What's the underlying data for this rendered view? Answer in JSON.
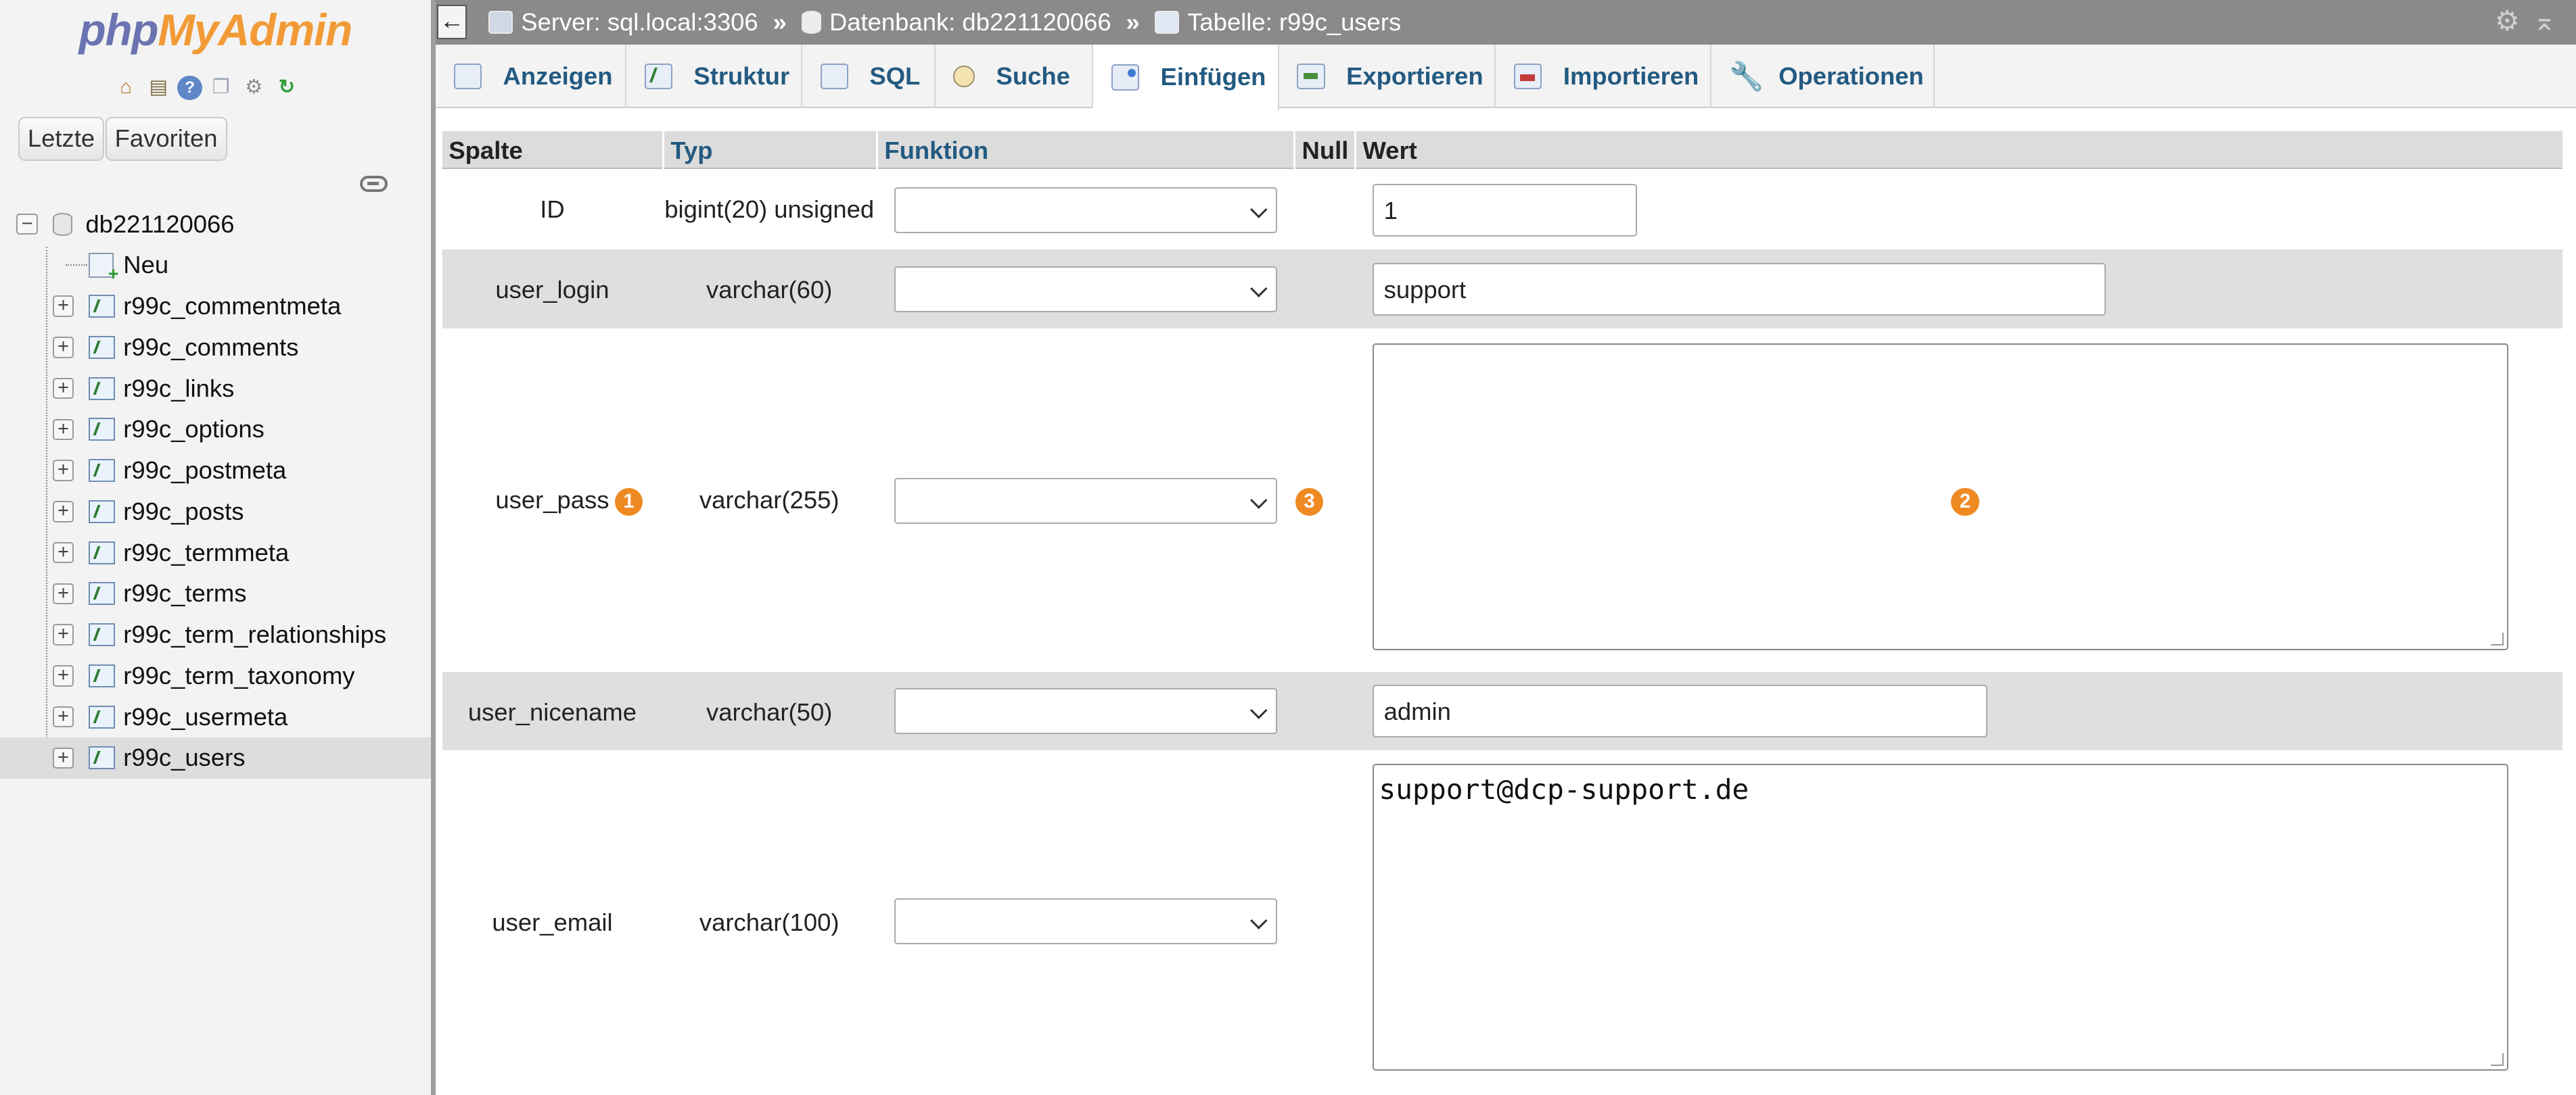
{
  "logo": {
    "part1": "php",
    "part2": "MyAdmin"
  },
  "nav": {
    "quick_icons": [
      "home-icon",
      "database-icon",
      "help-icon",
      "docs-icon",
      "settings-icon",
      "reload-icon"
    ],
    "tabs": [
      "Letzte",
      "Favoriten"
    ],
    "database": "db221120066",
    "new_label": "Neu",
    "tables": [
      "r99c_commentmeta",
      "r99c_comments",
      "r99c_links",
      "r99c_options",
      "r99c_postmeta",
      "r99c_posts",
      "r99c_termmeta",
      "r99c_terms",
      "r99c_term_relationships",
      "r99c_term_taxonomy",
      "r99c_usermeta",
      "r99c_users"
    ],
    "selected_table": "r99c_users"
  },
  "topbar": {
    "back": "←",
    "server": "Server: sql.local:3306",
    "separator": "»",
    "database": "Datenbank: db221120066",
    "table": "Tabelle: r99c_users"
  },
  "tabs": [
    "Anzeigen",
    "Struktur",
    "SQL",
    "Suche",
    "Einfügen",
    "Exportieren",
    "Importieren",
    "Operationen"
  ],
  "active_tab": "Einfügen",
  "columns": {
    "spalte": "Spalte",
    "typ": "Typ",
    "funktion": "Funktion",
    "null": "Null",
    "wert": "Wert"
  },
  "rows": [
    {
      "name": "ID",
      "type": "bigint(20) unsigned",
      "function": "",
      "value": "1"
    },
    {
      "name": "user_login",
      "type": "varchar(60)",
      "function": "",
      "value": "support"
    },
    {
      "name": "user_pass",
      "type": "varchar(255)",
      "function": "",
      "value": ""
    },
    {
      "name": "user_nicename",
      "type": "varchar(50)",
      "function": "",
      "value": "admin"
    },
    {
      "name": "user_email",
      "type": "varchar(100)",
      "function": "",
      "value": "support@dcp-support.de"
    }
  ],
  "annotations": [
    "1",
    "2",
    "3"
  ],
  "colors": {
    "accent_orange": "#ef8a22",
    "link_blue": "#235a81",
    "topbar_gray": "#8a8a8a"
  }
}
